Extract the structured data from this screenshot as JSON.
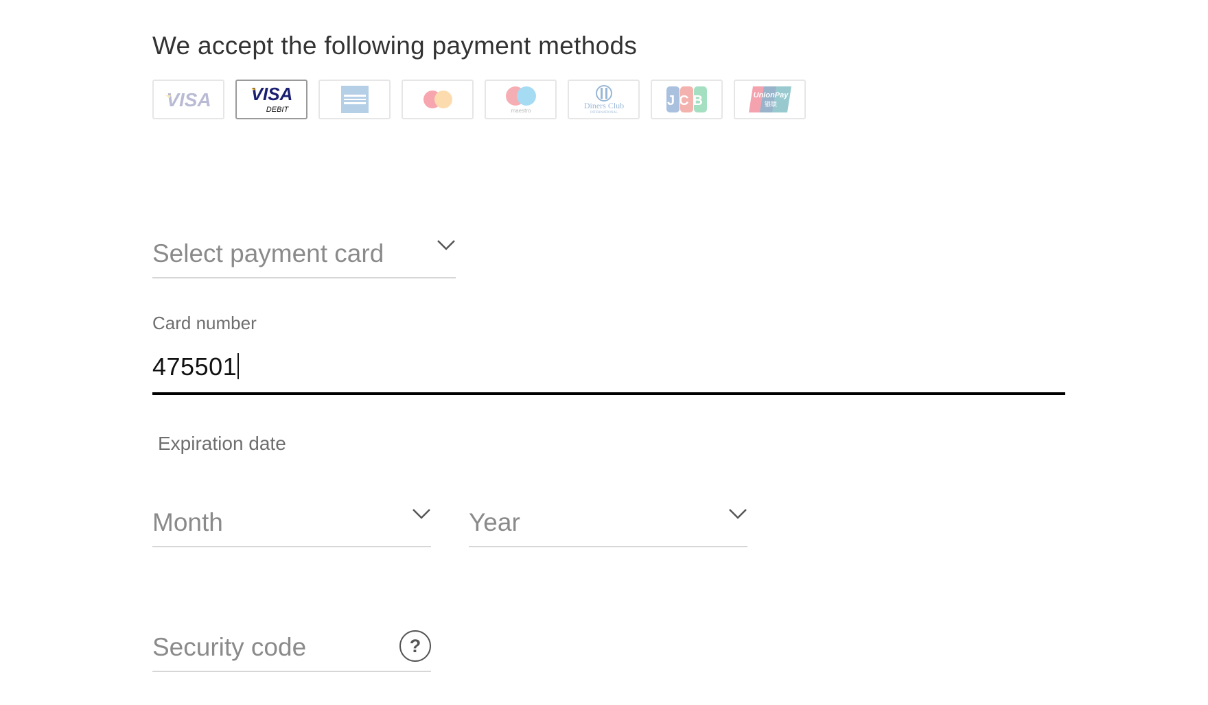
{
  "heading": "We accept the following payment methods",
  "payment_methods": [
    {
      "name": "Visa",
      "icon": "visa-icon",
      "state": "faded"
    },
    {
      "name": "Visa Debit",
      "icon": "visa-debit-icon",
      "state": "selected",
      "lines": [
        "VISA",
        "DEBIT"
      ]
    },
    {
      "name": "American Express",
      "icon": "amex-icon",
      "state": "faded"
    },
    {
      "name": "Mastercard",
      "icon": "mastercard-icon",
      "state": "faded"
    },
    {
      "name": "Maestro",
      "icon": "maestro-icon",
      "state": "faded",
      "text": "maestro"
    },
    {
      "name": "Diners Club International",
      "icon": "diners-club-icon",
      "state": "faded",
      "lines": [
        "Diners Club",
        "INTERNATIONAL"
      ]
    },
    {
      "name": "JCB",
      "icon": "jcb-icon",
      "state": "faded",
      "text": "JCB"
    },
    {
      "name": "UnionPay",
      "icon": "unionpay-icon",
      "state": "faded",
      "lines": [
        "UnionPay",
        "银联"
      ]
    }
  ],
  "select_card": {
    "placeholder": "Select payment card"
  },
  "card_number": {
    "label": "Card number",
    "value": "475501"
  },
  "expiration": {
    "label": "Expiration date",
    "month_placeholder": "Month",
    "year_placeholder": "Year"
  },
  "security_code": {
    "placeholder": "Security code",
    "help_label": "?"
  },
  "colors": {
    "visa_blue": "#1a1f71",
    "visa_gold": "#f7b600",
    "amex_blue": "#2e77bc",
    "mastercard_red": "#eb001b",
    "mastercard_orange": "#f79e1b",
    "maestro_red": "#e41c2a",
    "maestro_blue": "#0099df",
    "jcb_blue": "#0b4ea2",
    "jcb_red": "#e1251b",
    "jcb_green": "#00a650",
    "unionpay_red": "#e21836",
    "unionpay_teal": "#01798a",
    "active_underline": "#000000",
    "inactive_underline": "#d6d6d6"
  }
}
